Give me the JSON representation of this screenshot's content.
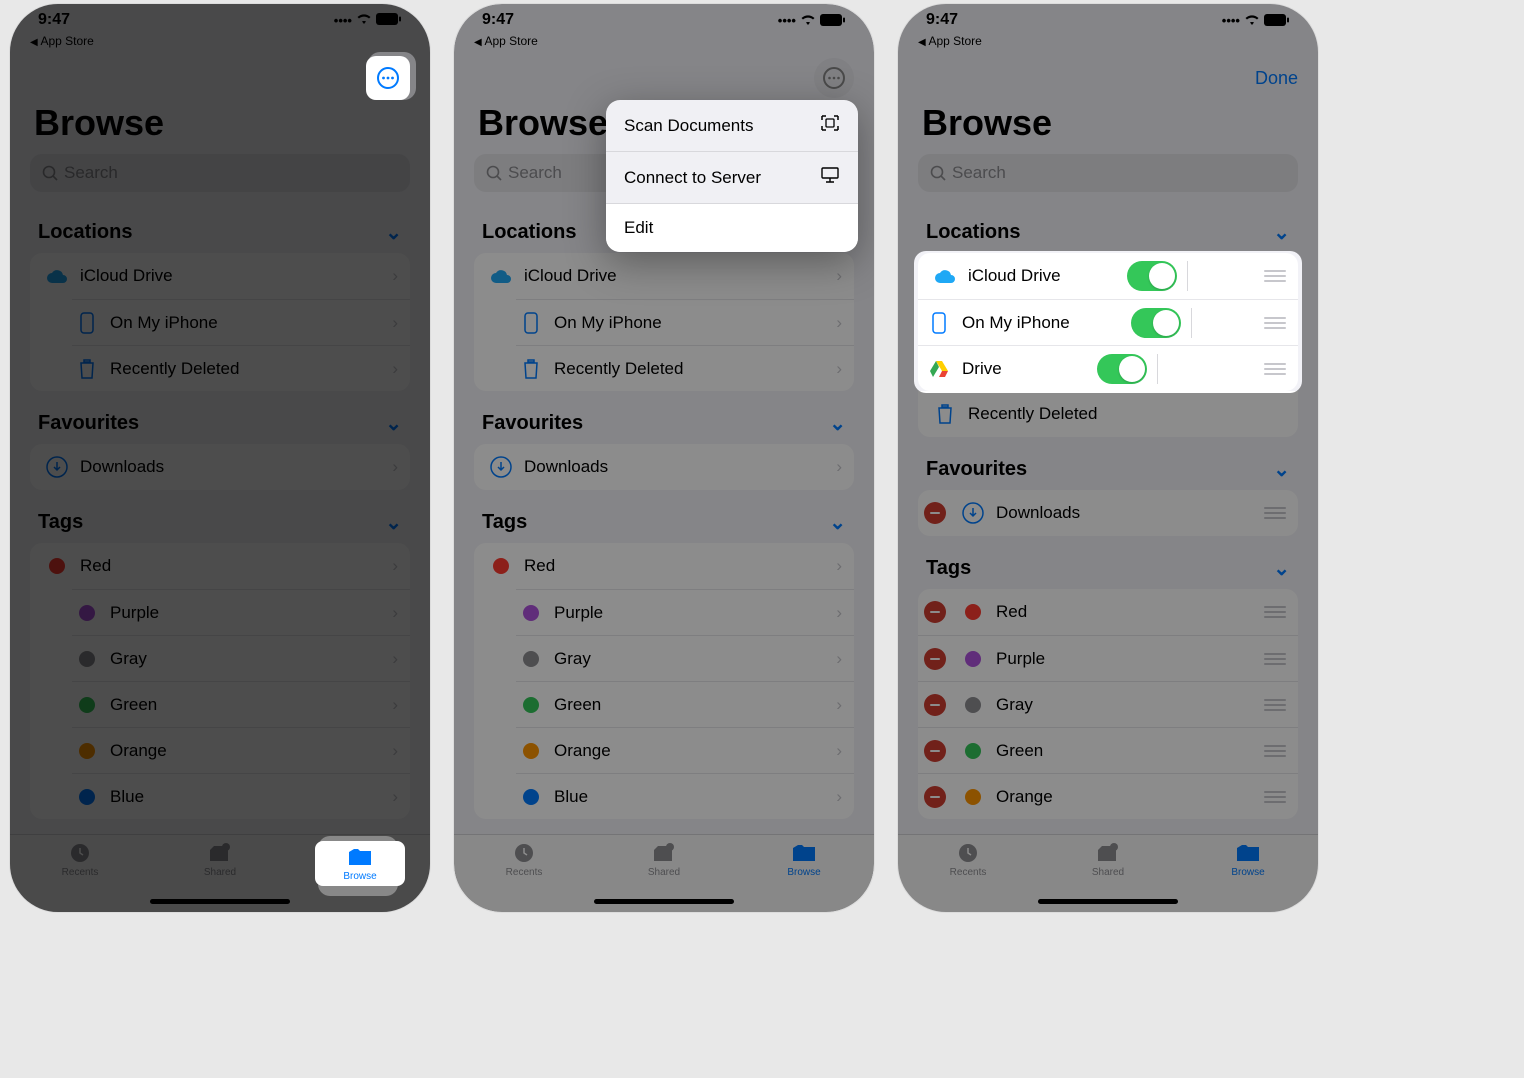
{
  "status": {
    "time": "9:47",
    "back_app": "App Store"
  },
  "header": {
    "title": "Browse",
    "done": "Done"
  },
  "search": {
    "placeholder": "Search"
  },
  "sections": {
    "locations": {
      "title": "Locations",
      "items": [
        {
          "label": "iCloud Drive",
          "icon": "icloud"
        },
        {
          "label": "On My iPhone",
          "icon": "iphone"
        },
        {
          "label": "Recently Deleted",
          "icon": "trash"
        }
      ],
      "edit_items": [
        {
          "label": "iCloud Drive",
          "icon": "icloud",
          "enabled": true
        },
        {
          "label": "On My iPhone",
          "icon": "iphone",
          "enabled": true
        },
        {
          "label": "Drive",
          "icon": "gdrive",
          "enabled": true
        }
      ],
      "recently_deleted": "Recently Deleted"
    },
    "favourites": {
      "title": "Favourites",
      "items": [
        {
          "label": "Downloads",
          "icon": "download"
        }
      ]
    },
    "tags": {
      "title": "Tags",
      "items": [
        {
          "label": "Red",
          "color": "#ff3b30"
        },
        {
          "label": "Purple",
          "color": "#af52de"
        },
        {
          "label": "Gray",
          "color": "#8e8e93"
        },
        {
          "label": "Green",
          "color": "#34c759"
        },
        {
          "label": "Orange",
          "color": "#ff9500"
        },
        {
          "label": "Blue",
          "color": "#007aff"
        }
      ],
      "edit_visible": [
        {
          "label": "Red",
          "color": "#ff3b30"
        },
        {
          "label": "Purple",
          "color": "#af52de"
        },
        {
          "label": "Gray",
          "color": "#8e8e93"
        },
        {
          "label": "Green",
          "color": "#34c759"
        },
        {
          "label": "Orange",
          "color": "#ff9500"
        }
      ]
    }
  },
  "menu": {
    "scan": "Scan Documents",
    "connect": "Connect to Server",
    "edit": "Edit"
  },
  "tabs": {
    "recents": "Recents",
    "shared": "Shared",
    "browse": "Browse"
  },
  "colors": {
    "tint": "#007aff",
    "toggle_on": "#34c759",
    "delete": "#ce3c30"
  }
}
